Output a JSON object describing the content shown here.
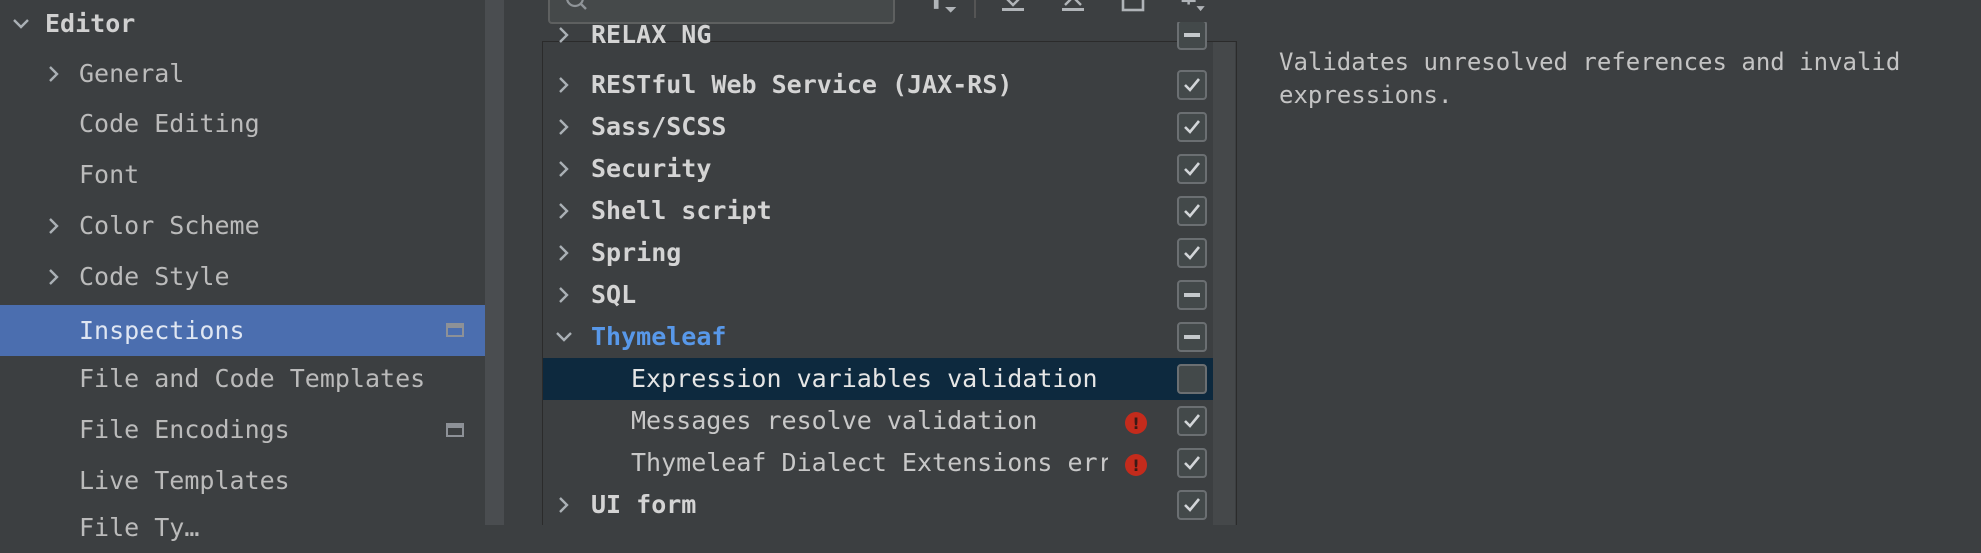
{
  "sidebar": {
    "title": "Editor",
    "items": [
      {
        "label": "General",
        "expandable": true
      },
      {
        "label": "Code Editing",
        "expandable": false
      },
      {
        "label": "Font",
        "expandable": false
      },
      {
        "label": "Color Scheme",
        "expandable": true
      },
      {
        "label": "Code Style",
        "expandable": true
      },
      {
        "label": "Inspections",
        "expandable": false,
        "selected": true,
        "badge": true
      },
      {
        "label": "File and Code Templates",
        "expandable": false
      },
      {
        "label": "File Encodings",
        "expandable": false,
        "badge": true
      },
      {
        "label": "Live Templates",
        "expandable": false
      },
      {
        "label": "File Ty…",
        "expandable": false
      }
    ]
  },
  "search": {
    "placeholder": ""
  },
  "toolbar": {
    "icons": [
      "filter-icon",
      "expand-all-icon",
      "collapse-all-icon",
      "reset-icon",
      "add-icon"
    ]
  },
  "tree": {
    "rows": [
      {
        "label": "RELAX NG",
        "type": "category",
        "expanded": false,
        "check": "partial"
      },
      {
        "label": "RESTful Web Service (JAX-RS)",
        "type": "category",
        "expanded": false,
        "check": "checked"
      },
      {
        "label": "Sass/SCSS",
        "type": "category",
        "expanded": false,
        "check": "checked"
      },
      {
        "label": "Security",
        "type": "category",
        "expanded": false,
        "check": "checked"
      },
      {
        "label": "Shell script",
        "type": "category",
        "expanded": false,
        "check": "checked"
      },
      {
        "label": "Spring",
        "type": "category",
        "expanded": false,
        "check": "checked"
      },
      {
        "label": "SQL",
        "type": "category",
        "expanded": false,
        "check": "partial"
      },
      {
        "label": "Thymeleaf",
        "type": "category",
        "expanded": true,
        "check": "partial"
      },
      {
        "label": "Expression variables validation",
        "type": "child",
        "selected": true,
        "check": "unchecked",
        "severity": ""
      },
      {
        "label": "Messages resolve validation",
        "type": "child",
        "check": "checked",
        "severity": "error"
      },
      {
        "label": "Thymeleaf Dialect Extensions errors",
        "type": "child",
        "check": "checked",
        "severity": "error"
      },
      {
        "label": "UI form",
        "type": "category",
        "expanded": false,
        "check": "checked"
      }
    ]
  },
  "description": {
    "text": "Validates unresolved references and invalid expressions."
  },
  "colors": {
    "background": "#3c3f41",
    "selection": "#4b6eaf",
    "tree_selection": "#0d293e",
    "link": "#5898e9",
    "error": "#c42b1c"
  }
}
